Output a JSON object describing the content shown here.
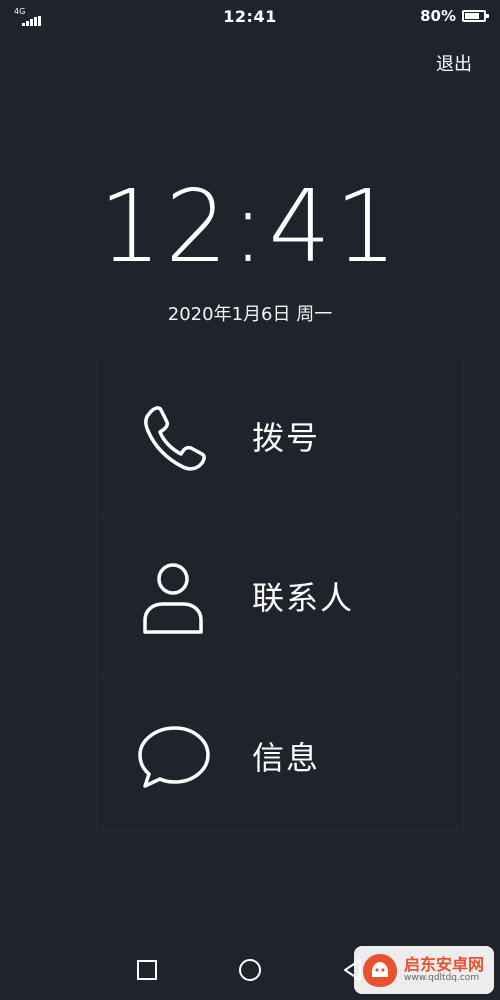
{
  "status_bar": {
    "network": "4G",
    "time": "12:41",
    "battery_percent_label": "80%",
    "battery_level": 0.8
  },
  "header": {
    "exit_label": "退出"
  },
  "clock": {
    "time": "12:41",
    "date": "2020年1月6日 周一"
  },
  "menu": {
    "items": [
      {
        "label": "拨号",
        "icon": "phone-icon"
      },
      {
        "label": "联系人",
        "icon": "person-icon"
      },
      {
        "label": "信息",
        "icon": "message-icon"
      }
    ]
  },
  "nav": {
    "recent_icon": "square-icon",
    "home_icon": "circle-icon",
    "back_icon": "triangle-back-icon"
  },
  "watermark": {
    "title": "启东安卓网",
    "url": "www.qdltdq.com"
  },
  "colors": {
    "background": "#1f232c",
    "foreground": "#ffffff",
    "divider": "#262a33",
    "watermark_accent": "#e8522f"
  }
}
